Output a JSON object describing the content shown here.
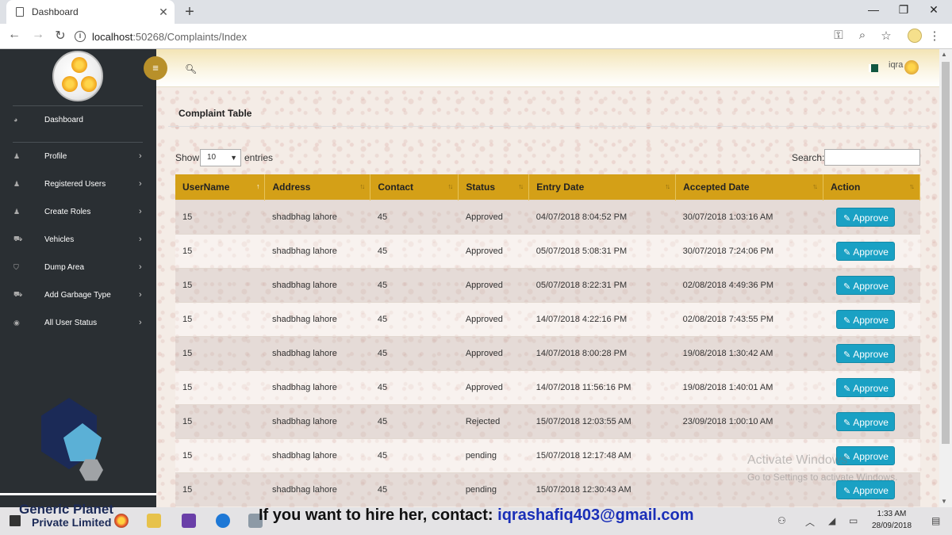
{
  "browser": {
    "tab_title": "Dashboard",
    "url_host": "localhost",
    "url_path": ":50268/Complaints/Index"
  },
  "header": {
    "user_name": "iqra"
  },
  "sidebar": {
    "items": [
      {
        "label": "Dashboard",
        "icon": "dashboard-icon"
      },
      {
        "label": "Profile",
        "icon": "user-icon"
      },
      {
        "label": "Registered Users",
        "icon": "user-icon"
      },
      {
        "label": "Create Roles",
        "icon": "user-icon"
      },
      {
        "label": "Vehicles",
        "icon": "truck-icon"
      },
      {
        "label": "Dump Area",
        "icon": "cart-icon"
      },
      {
        "label": "Add Garbage Type",
        "icon": "truck-icon"
      },
      {
        "label": "All User Status",
        "icon": "eye-icon"
      }
    ],
    "company_line1": "Generic Planet",
    "company_line2": "Private Limited"
  },
  "panel": {
    "title": "Complaint Table",
    "show_label": "Show",
    "entries_value": "10",
    "entries_label": "entries",
    "search_label": "Search:",
    "search_value": ""
  },
  "table": {
    "columns": [
      "UserName",
      "Address",
      "Contact",
      "Status",
      "Entry Date",
      "Accepted Date",
      "Action"
    ],
    "action_label": "Approve",
    "rows": [
      {
        "username": "15",
        "address": "shadbhag lahore",
        "contact": "45",
        "status": "Approved",
        "entry": "04/07/2018 8:04:52 PM",
        "accepted": "30/07/2018 1:03:16 AM"
      },
      {
        "username": "15",
        "address": "shadbhag lahore",
        "contact": "45",
        "status": "Approved",
        "entry": "05/07/2018 5:08:31 PM",
        "accepted": "30/07/2018 7:24:06 PM"
      },
      {
        "username": "15",
        "address": "shadbhag lahore",
        "contact": "45",
        "status": "Approved",
        "entry": "05/07/2018 8:22:31 PM",
        "accepted": "02/08/2018 4:49:36 PM"
      },
      {
        "username": "15",
        "address": "shadbhag lahore",
        "contact": "45",
        "status": "Approved",
        "entry": "14/07/2018 4:22:16 PM",
        "accepted": "02/08/2018 7:43:55 PM"
      },
      {
        "username": "15",
        "address": "shadbhag lahore",
        "contact": "45",
        "status": "Approved",
        "entry": "14/07/2018 8:00:28 PM",
        "accepted": "19/08/2018 1:30:42 AM"
      },
      {
        "username": "15",
        "address": "shadbhag lahore",
        "contact": "45",
        "status": "Approved",
        "entry": "14/07/2018 11:56:16 PM",
        "accepted": "19/08/2018 1:40:01 AM"
      },
      {
        "username": "15",
        "address": "shadbhag lahore",
        "contact": "45",
        "status": "Rejected",
        "entry": "15/07/2018 12:03:55 AM",
        "accepted": "23/09/2018 1:00:10 AM"
      },
      {
        "username": "15",
        "address": "shadbhag lahore",
        "contact": "45",
        "status": "pending",
        "entry": "15/07/2018 12:17:48 AM",
        "accepted": ""
      },
      {
        "username": "15",
        "address": "shadbhag lahore",
        "contact": "45",
        "status": "pending",
        "entry": "15/07/2018 12:30:43 AM",
        "accepted": ""
      }
    ]
  },
  "watermark": {
    "line1": "Activate Windows",
    "line2": "Go to Settings to activate Windows."
  },
  "taskbar": {
    "time": "1:33 AM",
    "date": "28/09/2018"
  },
  "overlay": {
    "hire_prefix": "If you want to hire her, contact: ",
    "hire_email": "iqrashafiq403@gmail.com"
  },
  "colors": {
    "sidebar_bg": "#2a2f33",
    "table_header": "#d4a017",
    "approve_button": "#1aa1c4",
    "status_approved": "#3c8a2e",
    "status_rejected": "#d93c3c",
    "status_pending": "#d63c8c"
  }
}
